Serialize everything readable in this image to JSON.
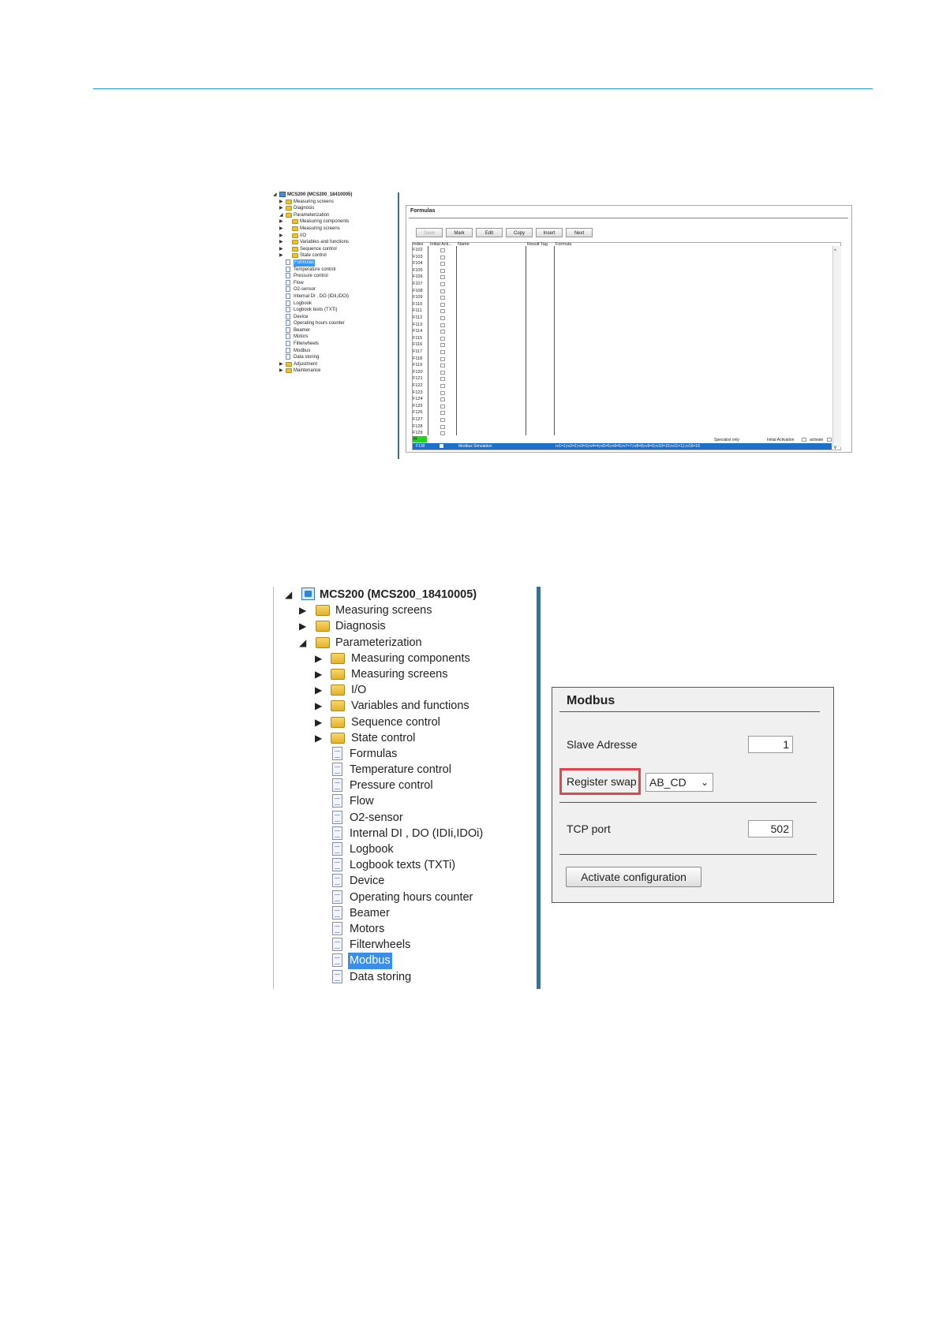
{
  "small_tree": {
    "items": [
      {
        "label": "MCS200 (MCS200_18410005)",
        "icon": "computer-icon",
        "arrow": "◢",
        "level": 0,
        "bold": true
      },
      {
        "label": "Measuring screens",
        "icon": "folder-icon",
        "arrow": "▶",
        "level": 1
      },
      {
        "label": "Diagnosis",
        "icon": "folder-icon",
        "arrow": "▶",
        "level": 1
      },
      {
        "label": "Parameterization",
        "icon": "folder-icon",
        "arrow": "◢",
        "level": 1
      },
      {
        "label": "Measuring components",
        "icon": "folder-icon",
        "arrow": "▶",
        "level": 2
      },
      {
        "label": "Measuring screens",
        "icon": "folder-icon",
        "arrow": "▶",
        "level": 2
      },
      {
        "label": "I/O",
        "icon": "folder-icon",
        "arrow": "▶",
        "level": 2
      },
      {
        "label": "Variables and functions",
        "icon": "folder-icon",
        "arrow": "▶",
        "level": 2
      },
      {
        "label": "Sequence control",
        "icon": "folder-icon",
        "arrow": "▶",
        "level": 2
      },
      {
        "label": "State control",
        "icon": "folder-icon",
        "arrow": "▶",
        "level": 2
      },
      {
        "label": "Formulas",
        "icon": "document-icon",
        "arrow": "",
        "level": 3,
        "selected": true
      },
      {
        "label": "Temperature control",
        "icon": "document-icon",
        "arrow": "",
        "level": 3
      },
      {
        "label": "Pressure control",
        "icon": "document-icon",
        "arrow": "",
        "level": 3
      },
      {
        "label": "Flow",
        "icon": "document-icon",
        "arrow": "",
        "level": 3
      },
      {
        "label": "O2-sensor",
        "icon": "document-icon",
        "arrow": "",
        "level": 3
      },
      {
        "label": "Internal DI , DO (IDIi,IDOi)",
        "icon": "document-icon",
        "arrow": "",
        "level": 3
      },
      {
        "label": "Logbook",
        "icon": "document-icon",
        "arrow": "",
        "level": 3
      },
      {
        "label": "Logbook texts (TXTi)",
        "icon": "document-icon",
        "arrow": "",
        "level": 3
      },
      {
        "label": "Device",
        "icon": "document-icon",
        "arrow": "",
        "level": 3
      },
      {
        "label": "Operating hours counter",
        "icon": "document-icon",
        "arrow": "",
        "level": 3
      },
      {
        "label": "Beamer",
        "icon": "document-icon",
        "arrow": "",
        "level": 3
      },
      {
        "label": "Motors",
        "icon": "document-icon",
        "arrow": "",
        "level": 3
      },
      {
        "label": "Filterwheels",
        "icon": "document-icon",
        "arrow": "",
        "level": 3
      },
      {
        "label": "Modbus",
        "icon": "document-icon",
        "arrow": "",
        "level": 3
      },
      {
        "label": "Data storing",
        "icon": "document-icon",
        "arrow": "",
        "level": 3
      },
      {
        "label": "Adjustment",
        "icon": "folder-icon",
        "arrow": "▶",
        "level": 1
      },
      {
        "label": "Maintenance",
        "icon": "folder-icon",
        "arrow": "▶",
        "level": 1
      }
    ]
  },
  "formulas": {
    "title": "Formulas",
    "buttons": [
      {
        "label": "Save",
        "disabled": true
      },
      {
        "label": "Mark"
      },
      {
        "label": "Edit"
      },
      {
        "label": "Copy"
      },
      {
        "label": "Insert"
      },
      {
        "label": "Next"
      }
    ],
    "columns": [
      "Index",
      "Initial Acti...",
      "Name",
      "Result Tag",
      "Formula"
    ],
    "rows": [
      "F102",
      "F103",
      "F104",
      "F105",
      "F106",
      "F107",
      "F108",
      "F109",
      "F110",
      "F111",
      "F112",
      "F113",
      "F114",
      "F115",
      "F116",
      "F117",
      "F118",
      "F119",
      "F120",
      "F121",
      "F122",
      "F123",
      "F124",
      "F125",
      "F126",
      "F127",
      "F128",
      "F129"
    ],
    "green_row_label": "94",
    "specialist_only": "Specialist only",
    "initial_activation": "Initial Activation",
    "activate": "activate",
    "selected_row": {
      "index": "F130",
      "name": "Modbus Simulation",
      "formula": "rv1=1;rv2=2;rv3=3;rv4=4;rv5=5;rv6=6;rv7=7;rv8=8;rv9=9;rv10=10;rv11=11;rv16=16"
    }
  },
  "big_tree": {
    "items": [
      {
        "label": "MCS200 (MCS200_18410005)",
        "icon": "computer-icon",
        "arrow": "◢",
        "level": 0,
        "bold": true
      },
      {
        "label": "Measuring screens",
        "icon": "folder-icon",
        "arrow": "▶",
        "level": 1
      },
      {
        "label": "Diagnosis",
        "icon": "folder-icon",
        "arrow": "▶",
        "level": 1
      },
      {
        "label": "Parameterization",
        "icon": "folder-icon",
        "arrow": "◢",
        "level": 1
      },
      {
        "label": "Measuring components",
        "icon": "folder-icon",
        "arrow": "▶",
        "level": 2
      },
      {
        "label": "Measuring screens",
        "icon": "folder-icon",
        "arrow": "▶",
        "level": 2
      },
      {
        "label": "I/O",
        "icon": "folder-icon",
        "arrow": "▶",
        "level": 2
      },
      {
        "label": "Variables and functions",
        "icon": "folder-icon",
        "arrow": "▶",
        "level": 2
      },
      {
        "label": "Sequence control",
        "icon": "folder-icon",
        "arrow": "▶",
        "level": 2
      },
      {
        "label": "State control",
        "icon": "folder-icon",
        "arrow": "▶",
        "level": 2
      },
      {
        "label": "Formulas",
        "icon": "document-icon",
        "arrow": "",
        "level": 3
      },
      {
        "label": "Temperature control",
        "icon": "document-icon",
        "arrow": "",
        "level": 3
      },
      {
        "label": "Pressure control",
        "icon": "document-icon",
        "arrow": "",
        "level": 3
      },
      {
        "label": "Flow",
        "icon": "document-icon",
        "arrow": "",
        "level": 3
      },
      {
        "label": "O2-sensor",
        "icon": "document-icon",
        "arrow": "",
        "level": 3
      },
      {
        "label": "Internal DI , DO (IDIi,IDOi)",
        "icon": "document-icon",
        "arrow": "",
        "level": 3
      },
      {
        "label": "Logbook",
        "icon": "document-icon",
        "arrow": "",
        "level": 3
      },
      {
        "label": "Logbook texts (TXTi)",
        "icon": "document-icon",
        "arrow": "",
        "level": 3
      },
      {
        "label": "Device",
        "icon": "document-icon",
        "arrow": "",
        "level": 3
      },
      {
        "label": "Operating hours counter",
        "icon": "document-icon",
        "arrow": "",
        "level": 3
      },
      {
        "label": "Beamer",
        "icon": "document-icon",
        "arrow": "",
        "level": 3
      },
      {
        "label": "Motors",
        "icon": "document-icon",
        "arrow": "",
        "level": 3
      },
      {
        "label": "Filterwheels",
        "icon": "document-icon",
        "arrow": "",
        "level": 3
      },
      {
        "label": "Modbus",
        "icon": "document-icon",
        "arrow": "",
        "level": 3,
        "selected": true
      },
      {
        "label": "Data storing",
        "icon": "document-icon",
        "arrow": "",
        "level": 3
      }
    ]
  },
  "modbus": {
    "title": "Modbus",
    "slave_label": "Slave Adresse",
    "slave_value": "1",
    "register_label": "Register swap",
    "register_value": "AB_CD",
    "tcp_label": "TCP port",
    "tcp_value": "502",
    "activate_label": "Activate configuration"
  },
  "colors": {
    "accent_line": "#2aa5d6",
    "selection": "#3a8ee6",
    "highlight_box": "#e0464f",
    "green_row": "#27d11f"
  }
}
